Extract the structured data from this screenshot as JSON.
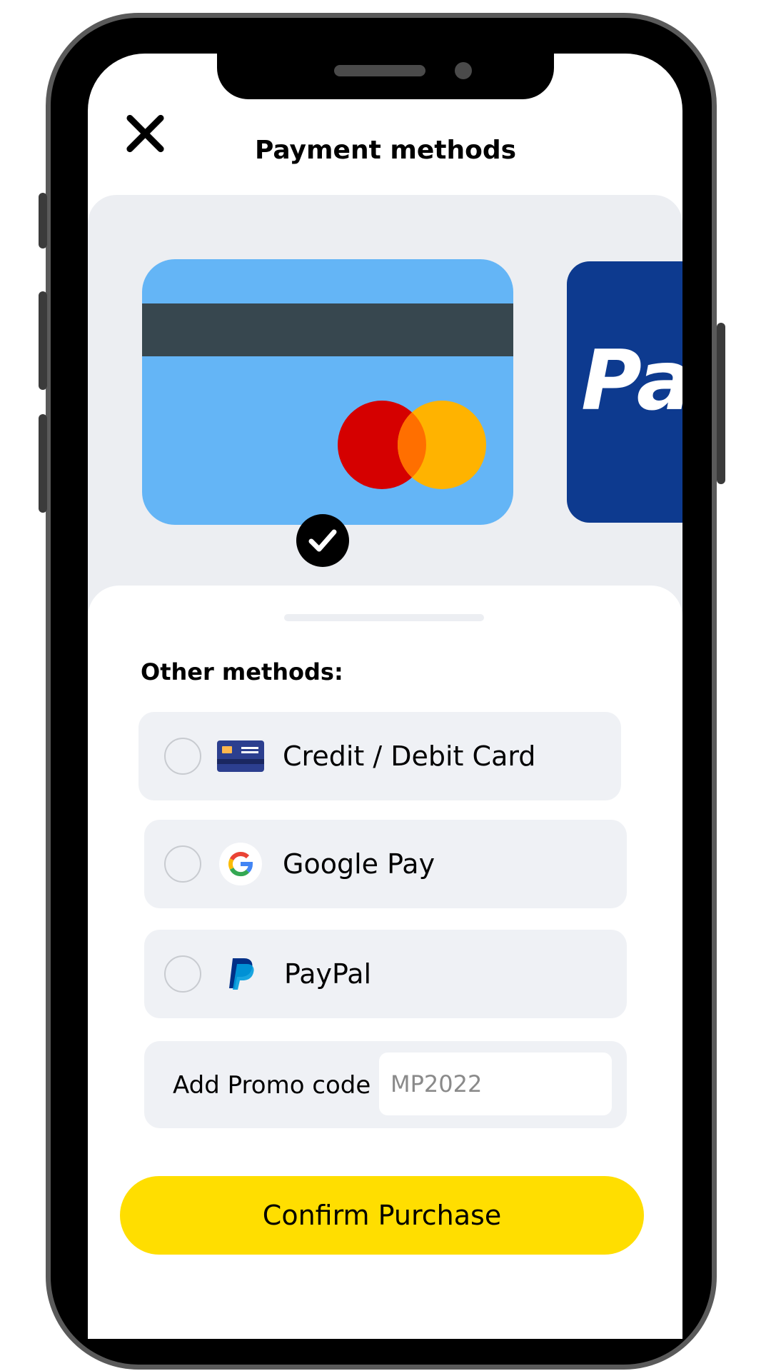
{
  "header": {
    "title": "Payment methods",
    "close_icon": "close-icon"
  },
  "carousel": {
    "cards": [
      {
        "type": "mastercard",
        "selected": true,
        "color": "#64b5f6"
      },
      {
        "type": "paypal",
        "partial_text": "Pa",
        "color": "#0d3a8f"
      }
    ],
    "selected_icon": "check-icon"
  },
  "other_methods": {
    "label": "Other methods:",
    "items": [
      {
        "label": "Credit / Debit Card",
        "icon": "credit-card-icon",
        "selected": false
      },
      {
        "label": "Google Pay",
        "icon": "google-icon",
        "selected": false
      },
      {
        "label": "PayPal",
        "icon": "paypal-icon",
        "selected": false
      }
    ]
  },
  "promo": {
    "label": "Add Promo code",
    "placeholder": "MP2022"
  },
  "confirm_button": {
    "label": "Confirm Purchase",
    "color": "#ffde00"
  }
}
